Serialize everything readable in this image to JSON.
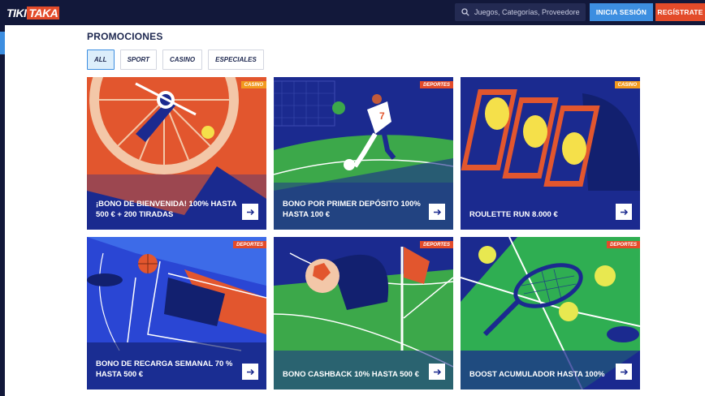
{
  "header": {
    "logo_left": "TIKI",
    "logo_right": "TAKA",
    "search_placeholder": "Juegos, Categorías, Proveedores",
    "login_label": "INICIA SESIÓN",
    "register_label": "REGÍSTRATE"
  },
  "page": {
    "title": "PROMOCIONES"
  },
  "filters": [
    "ALL",
    "SPORT",
    "CASINO",
    "ESPECIALES"
  ],
  "active_filter": "ALL",
  "promos": [
    {
      "tag": "CASINO",
      "title": "¡BONO DE BIENVENIDA! 100% HASTA 500 € + 200 TIRADAS"
    },
    {
      "tag": "DEPORTES",
      "title": "BONO POR PRIMER DEPÓSITO 100% HASTA 100 €"
    },
    {
      "tag": "CASINO",
      "title": "ROULETTE RUN 8.000 €"
    },
    {
      "tag": "DEPORTES",
      "title": "BONO DE RECARGA SEMANAL 70 % HASTA 500 €"
    },
    {
      "tag": "DEPORTES",
      "title": "BONO CASHBACK 10% HASTA 500 €"
    },
    {
      "tag": "DEPORTES",
      "title": "BOOST ACUMULADOR HASTA 100%"
    }
  ],
  "colors": {
    "navy": "#12183a",
    "accent_blue": "#3d8ee0",
    "accent_red": "#e34b2a",
    "casino_tag": "#f29a1f"
  }
}
